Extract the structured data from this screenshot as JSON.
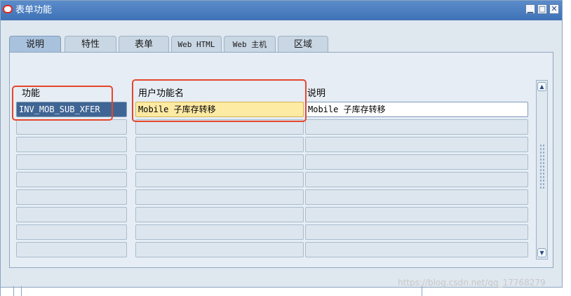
{
  "window": {
    "title": "表单功能",
    "buttons": {
      "minimize": "▁",
      "maximize": "□",
      "close": "✕"
    }
  },
  "tabs": [
    {
      "label": "说明",
      "active": true
    },
    {
      "label": "特性",
      "active": false
    },
    {
      "label": "表单",
      "active": false
    },
    {
      "label": "Web HTML",
      "active": false
    },
    {
      "label": "Web 主机",
      "active": false
    },
    {
      "label": "区域",
      "active": false
    }
  ],
  "table": {
    "columns": [
      "功能",
      "用户功能名",
      "说明"
    ],
    "rows": [
      [
        "INV_MOB_SUB_XFER",
        "Mobile 子库存转移",
        "Mobile 子库存转移"
      ],
      [
        "",
        "",
        ""
      ],
      [
        "",
        "",
        ""
      ],
      [
        "",
        "",
        ""
      ],
      [
        "",
        "",
        ""
      ],
      [
        "",
        "",
        ""
      ],
      [
        "",
        "",
        ""
      ],
      [
        "",
        "",
        ""
      ],
      [
        "",
        "",
        ""
      ]
    ]
  },
  "scrollbar": {
    "up": "▲",
    "down": "▼"
  },
  "watermark": "https://blog.csdn.net/qq_17768279",
  "colors": {
    "titlebar": "#3f72b6",
    "highlight": "#fdeaa3",
    "annotation": "#e4462c",
    "selection": "#3f6594"
  }
}
